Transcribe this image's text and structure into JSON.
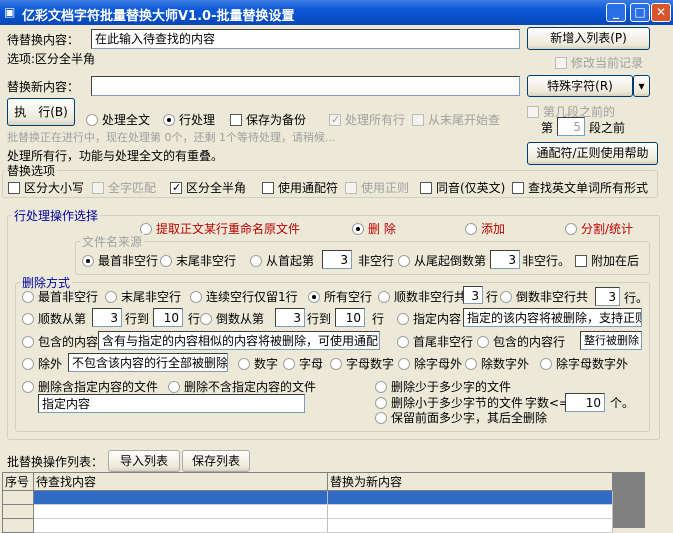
{
  "window": {
    "title": "亿彩文档字符批量替换大师V1.0-批量替换设置",
    "minimize": "_",
    "maximize": "□",
    "close": "✕"
  },
  "find": {
    "label": "待替换内容：",
    "value": "在此输入待查找的内容",
    "options_text": "选项:区分全半角"
  },
  "replace": {
    "label": "替换新内容：",
    "value": ""
  },
  "buttons": {
    "add_to_list": "新增入列表(P)",
    "special_chars": "特殊字符(R)",
    "dropdown": "▾",
    "execute": "执　行(B)",
    "help": "通配符/正则使用帮助",
    "import": "导入列表",
    "save": "保存列表"
  },
  "modify_record": "修改当前记录",
  "mode": {
    "full_text": "处理全文",
    "line": "行处理",
    "backup": "保存为备份",
    "all_lines": "处理所有行",
    "from_end": "从末尾开始查"
  },
  "before_para": {
    "label": "第几段之前的",
    "prefix": "第",
    "value": "5",
    "suffix": "段之前"
  },
  "status": "批替换正在进行中，现在处理第 0个，还剩 1个等待处理，请稍候...",
  "note": "处理所有行，功能与处理全文的有重叠。",
  "replace_options": {
    "title": "替换选项",
    "items": [
      "区分大小写",
      "全字匹配",
      "区分全半角",
      "使用通配符",
      "使用正则",
      "同音(仅英文)",
      "查找英文单词所有形式"
    ]
  },
  "line_ops": {
    "title": "行处理操作选择",
    "extract": "提取正文某行重命名原文件",
    "delete": "删 除",
    "add": "添加",
    "split": "分割/统计"
  },
  "filename_source": {
    "title": "文件名来源",
    "first": "最首非空行",
    "last": "末尾非空行",
    "from_start": "从首起第",
    "from_start_value": "3",
    "nonempty": "非空行",
    "from_end": "从尾起倒数第",
    "from_end_value": "3",
    "nonempty2": "非空行。",
    "append": "附加在后"
  },
  "delete_mode": {
    "title": "删除方式",
    "first_nonempty": "最首非空行",
    "last_nonempty": "末尾非空行",
    "keep_one_blank": "连续空行仅留1行",
    "all_blank": "所有空行",
    "fwd_nonempty": "顺数非空行共",
    "fwd_nonempty_value": "3",
    "row": "行",
    "back_nonempty": "倒数非空行共",
    "back_nonempty_value": "3",
    "row_end": "行。",
    "fwd_from": "顺数从第",
    "fwd_from_value": "3",
    "to": "行到",
    "fwd_to_value": "10",
    "back_from": "倒数从第",
    "back_from_value": "3",
    "back_to_value": "10",
    "specified": "指定内容",
    "specified_value": "指定的该内容将被删除，支持正则",
    "contains": "包含的内容",
    "contains_value": "含有与指定的内容相似的内容将被删除，可使用通配符",
    "head_tail": "首尾非空行",
    "contains_line": "包含的内容行",
    "contains_line_value": "整行被删除",
    "except": "除外",
    "except_value": "不包含该内容的行全部被删除",
    "digits": "数字",
    "letters": "字母",
    "alnum": "字母数字",
    "non_letters": "除字母外",
    "non_digits": "除数字外",
    "non_alnum": "除字母数字外",
    "del_with": "删除含指定内容的文件",
    "del_without": "删除不含指定内容的文件",
    "file_content_value": "指定内容",
    "del_fewer_chars": "删除少于多少字的文件",
    "del_smaller_bytes": "删除小于多少字节的文件",
    "char_count": "字数<=",
    "char_count_value": "10",
    "unit": "个。",
    "keep_first": "保留前面多少字，其后全删除"
  },
  "list": {
    "label": "批替换操作列表：",
    "columns": [
      "序号",
      "待查找内容",
      "替换为新内容"
    ]
  },
  "colors": {
    "title": "#0a58d8",
    "selection": "#316ac5",
    "red": "#c00000",
    "blue": "#0000a0"
  }
}
